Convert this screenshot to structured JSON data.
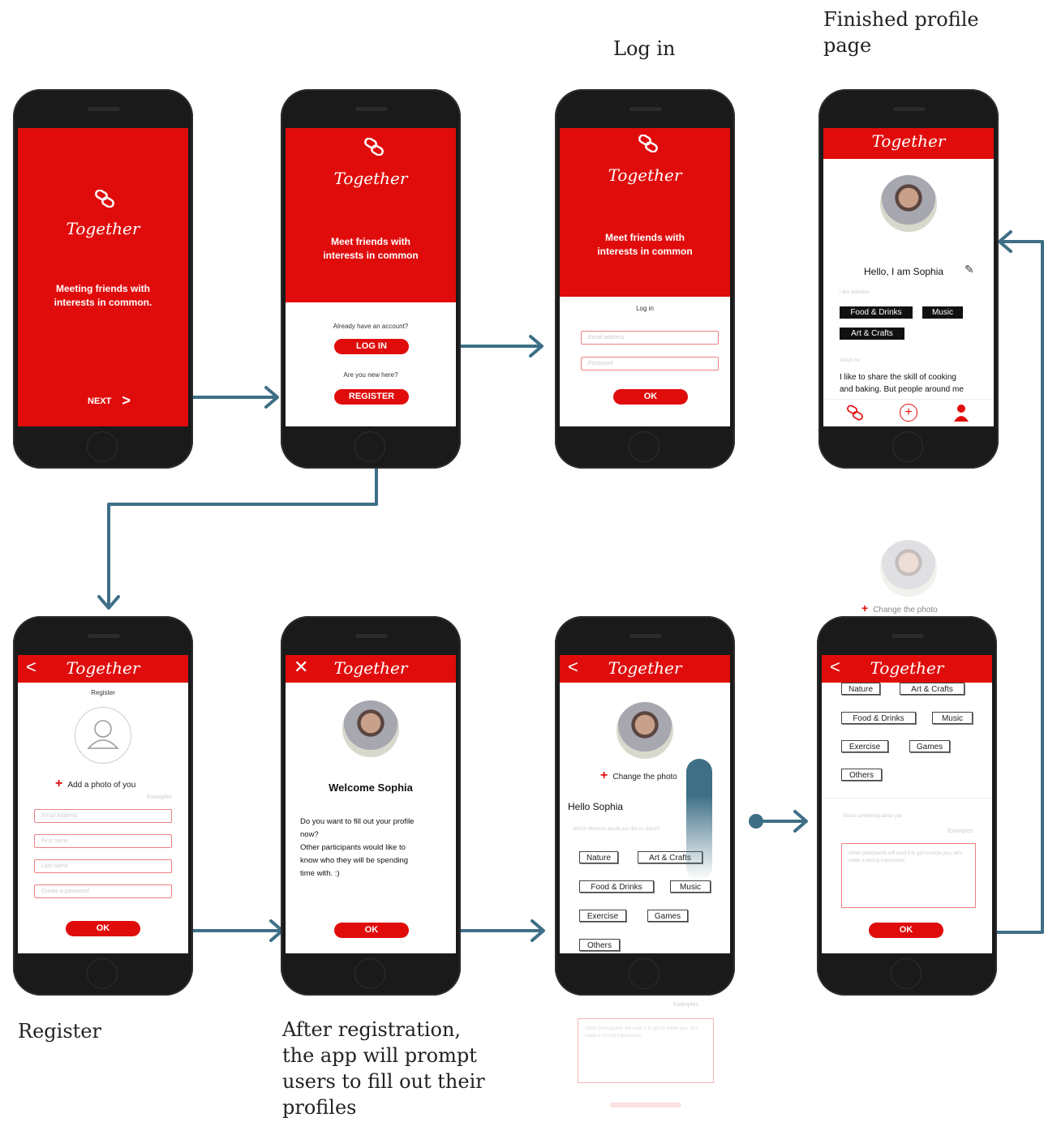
{
  "app_name": "Together",
  "colors": {
    "brand_red": "#e00c0c",
    "arrow": "#3e6f86"
  },
  "captions": {
    "finished_profile": "Finished profile page",
    "log_in": "Log in",
    "register": "Register",
    "after_registration": "After registration, the app will prompt users to fill out their profiles"
  },
  "screen1": {
    "tagline_line1": "Meeting friends with",
    "tagline_line2": "interests in common.",
    "next": "NEXT"
  },
  "screen2": {
    "tagline_line1": "Meet friends with",
    "tagline_line2": "interests in common",
    "have_account": "Already have an account?",
    "login": "LOG IN",
    "new_here": "Are you new here?",
    "register": "REGISTER"
  },
  "screen3": {
    "tagline_line1": "Meet friends with",
    "tagline_line2": "interests in common",
    "title": "Log in",
    "email_placeholder": "Email address",
    "password_placeholder": "Password",
    "ok": "OK"
  },
  "screen4": {
    "greeting": "Hello, I am Sophia",
    "interests_label": "I like activities",
    "chips": [
      "Food & Drinks",
      "Music",
      "Art & Crafts"
    ],
    "about_label": "About me",
    "about_text_line1": "I like to share the skill of cooking",
    "about_text_line2": "and baking. But people around me"
  },
  "screen5": {
    "title": "Register",
    "add_photo": "Add a photo of you",
    "examples": "Examples",
    "fields": [
      "Email Address",
      "First name",
      "Last name",
      "Create a password"
    ],
    "ok": "OK"
  },
  "screen6": {
    "welcome": "Welcome Sophia",
    "prompt_line1": "Do you want to fill out your profile",
    "prompt_line2": "now?",
    "prompt_line3": "Other participants would like to",
    "prompt_line4": "know who they will be spending",
    "prompt_line5": "time with. :)",
    "ok": "OK"
  },
  "screen7": {
    "change_photo": "Change the photo",
    "hello": "Hello Sophia",
    "subtitle": "Which interests would you like to share?",
    "chips": [
      "Nature",
      "Art & Crafts",
      "Food & Drinks",
      "Music",
      "Exercise",
      "Games",
      "Others"
    ],
    "examples": "Examples",
    "bio_placeholder": "Other participants will read it to get to know you, let's make a strong impression."
  },
  "screen8": {
    "change_photo": "Change the photo",
    "chips": [
      "Nature",
      "Art & Crafts",
      "Food & Drinks",
      "Music",
      "Exercise",
      "Games",
      "Others"
    ],
    "about_prompt": "Share something about you",
    "examples": "Examples",
    "bio_placeholder": "Other participants will read it to get to know you, let's make a strong impression.",
    "ok": "OK"
  }
}
